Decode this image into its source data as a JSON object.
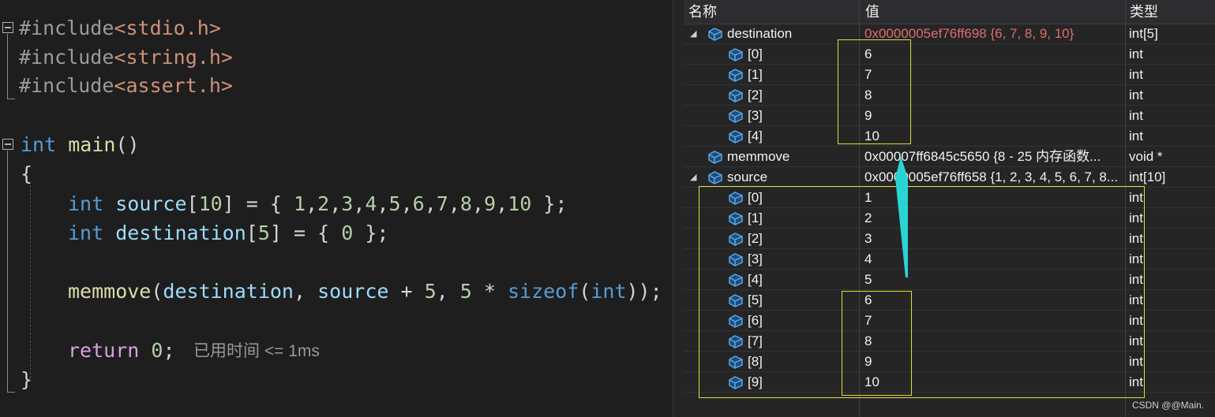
{
  "editor": {
    "lines": [
      {
        "parts": [
          {
            "t": "#include",
            "c": "pre"
          },
          {
            "t": "<stdio.h>",
            "c": "str"
          }
        ]
      },
      {
        "parts": [
          {
            "t": "#include",
            "c": "pre"
          },
          {
            "t": "<string.h>",
            "c": "str"
          }
        ]
      },
      {
        "parts": [
          {
            "t": "#include",
            "c": "pre"
          },
          {
            "t": "<assert.h>",
            "c": "str"
          }
        ]
      },
      {
        "parts": [
          {
            "t": "int",
            "c": "kw"
          },
          {
            "t": " ",
            "c": "pun"
          },
          {
            "t": "main",
            "c": "fn"
          },
          {
            "t": "()",
            "c": "pun"
          }
        ]
      },
      {
        "parts": [
          {
            "t": "{",
            "c": "pun"
          }
        ]
      },
      {
        "parts": [
          {
            "t": "int",
            "c": "kw"
          },
          {
            "t": " ",
            "c": "pun"
          },
          {
            "t": "source",
            "c": "var"
          },
          {
            "t": "[",
            "c": "pun"
          },
          {
            "t": "10",
            "c": "num"
          },
          {
            "t": "] = { ",
            "c": "pun"
          },
          {
            "t": "1",
            "c": "num"
          },
          {
            "t": ",",
            "c": "pun"
          },
          {
            "t": "2",
            "c": "num"
          },
          {
            "t": ",",
            "c": "pun"
          },
          {
            "t": "3",
            "c": "num"
          },
          {
            "t": ",",
            "c": "pun"
          },
          {
            "t": "4",
            "c": "num"
          },
          {
            "t": ",",
            "c": "pun"
          },
          {
            "t": "5",
            "c": "num"
          },
          {
            "t": ",",
            "c": "pun"
          },
          {
            "t": "6",
            "c": "num"
          },
          {
            "t": ",",
            "c": "pun"
          },
          {
            "t": "7",
            "c": "num"
          },
          {
            "t": ",",
            "c": "pun"
          },
          {
            "t": "8",
            "c": "num"
          },
          {
            "t": ",",
            "c": "pun"
          },
          {
            "t": "9",
            "c": "num"
          },
          {
            "t": ",",
            "c": "pun"
          },
          {
            "t": "10",
            "c": "num"
          },
          {
            "t": " };",
            "c": "pun"
          }
        ]
      },
      {
        "parts": [
          {
            "t": "int",
            "c": "kw"
          },
          {
            "t": " ",
            "c": "pun"
          },
          {
            "t": "destination",
            "c": "var"
          },
          {
            "t": "[",
            "c": "pun"
          },
          {
            "t": "5",
            "c": "num"
          },
          {
            "t": "] = { ",
            "c": "pun"
          },
          {
            "t": "0",
            "c": "num"
          },
          {
            "t": " };",
            "c": "pun"
          }
        ]
      },
      {
        "parts": [
          {
            "t": "memmove",
            "c": "fn"
          },
          {
            "t": "(",
            "c": "pun"
          },
          {
            "t": "destination",
            "c": "var"
          },
          {
            "t": ", ",
            "c": "pun"
          },
          {
            "t": "source",
            "c": "var"
          },
          {
            "t": " + ",
            "c": "pun"
          },
          {
            "t": "5",
            "c": "num"
          },
          {
            "t": ", ",
            "c": "pun"
          },
          {
            "t": "5",
            "c": "num"
          },
          {
            "t": " * ",
            "c": "pun"
          },
          {
            "t": "sizeof",
            "c": "kw"
          },
          {
            "t": "(",
            "c": "pun"
          },
          {
            "t": "int",
            "c": "kw"
          },
          {
            "t": "));",
            "c": "pun"
          }
        ]
      },
      {
        "parts": [
          {
            "t": "return",
            "c": "kw2"
          },
          {
            "t": " ",
            "c": "pun"
          },
          {
            "t": "0",
            "c": "num"
          },
          {
            "t": ";",
            "c": "pun"
          }
        ]
      },
      {
        "parts": [
          {
            "t": "}",
            "c": "pun"
          }
        ]
      }
    ],
    "perf_hint": "已用时间 <= 1ms"
  },
  "watch": {
    "headers": {
      "name": "名称",
      "value": "值",
      "type": "类型"
    },
    "rows": [
      {
        "name": "destination",
        "value": "0x0000005ef76ff698 {6, 7, 8, 9, 10}",
        "type": "int[5]",
        "level": 0,
        "expanded": true,
        "value_changed": true
      },
      {
        "name": "[0]",
        "value": "6",
        "type": "int",
        "level": 1
      },
      {
        "name": "[1]",
        "value": "7",
        "type": "int",
        "level": 1
      },
      {
        "name": "[2]",
        "value": "8",
        "type": "int",
        "level": 1
      },
      {
        "name": "[3]",
        "value": "9",
        "type": "int",
        "level": 1
      },
      {
        "name": "[4]",
        "value": "10",
        "type": "int",
        "level": 1
      },
      {
        "name": "memmove",
        "value": "0x00007ff6845c5650 {8 - 25 内存函数...",
        "type": "void *",
        "level": 0
      },
      {
        "name": "source",
        "value": "0x0000005ef76ff658 {1, 2, 3, 4, 5, 6, 7, 8...",
        "type": "int[10]",
        "level": 0,
        "expanded": true
      },
      {
        "name": "[0]",
        "value": "1",
        "type": "int",
        "level": 1
      },
      {
        "name": "[1]",
        "value": "2",
        "type": "int",
        "level": 1
      },
      {
        "name": "[2]",
        "value": "3",
        "type": "int",
        "level": 1
      },
      {
        "name": "[3]",
        "value": "4",
        "type": "int",
        "level": 1
      },
      {
        "name": "[4]",
        "value": "5",
        "type": "int",
        "level": 1
      },
      {
        "name": "[5]",
        "value": "6",
        "type": "int",
        "level": 1
      },
      {
        "name": "[6]",
        "value": "7",
        "type": "int",
        "level": 1
      },
      {
        "name": "[7]",
        "value": "8",
        "type": "int",
        "level": 1
      },
      {
        "name": "[8]",
        "value": "9",
        "type": "int",
        "level": 1
      },
      {
        "name": "[9]",
        "value": "10",
        "type": "int",
        "level": 1
      }
    ],
    "expander_glyph": "◢",
    "icon": "variable-cube-icon"
  },
  "watermark": "CSDN @@Main.",
  "colors": {
    "highlight": "#dede3c",
    "arrow": "#2ad4d4",
    "changed_value": "#e06c6c"
  }
}
